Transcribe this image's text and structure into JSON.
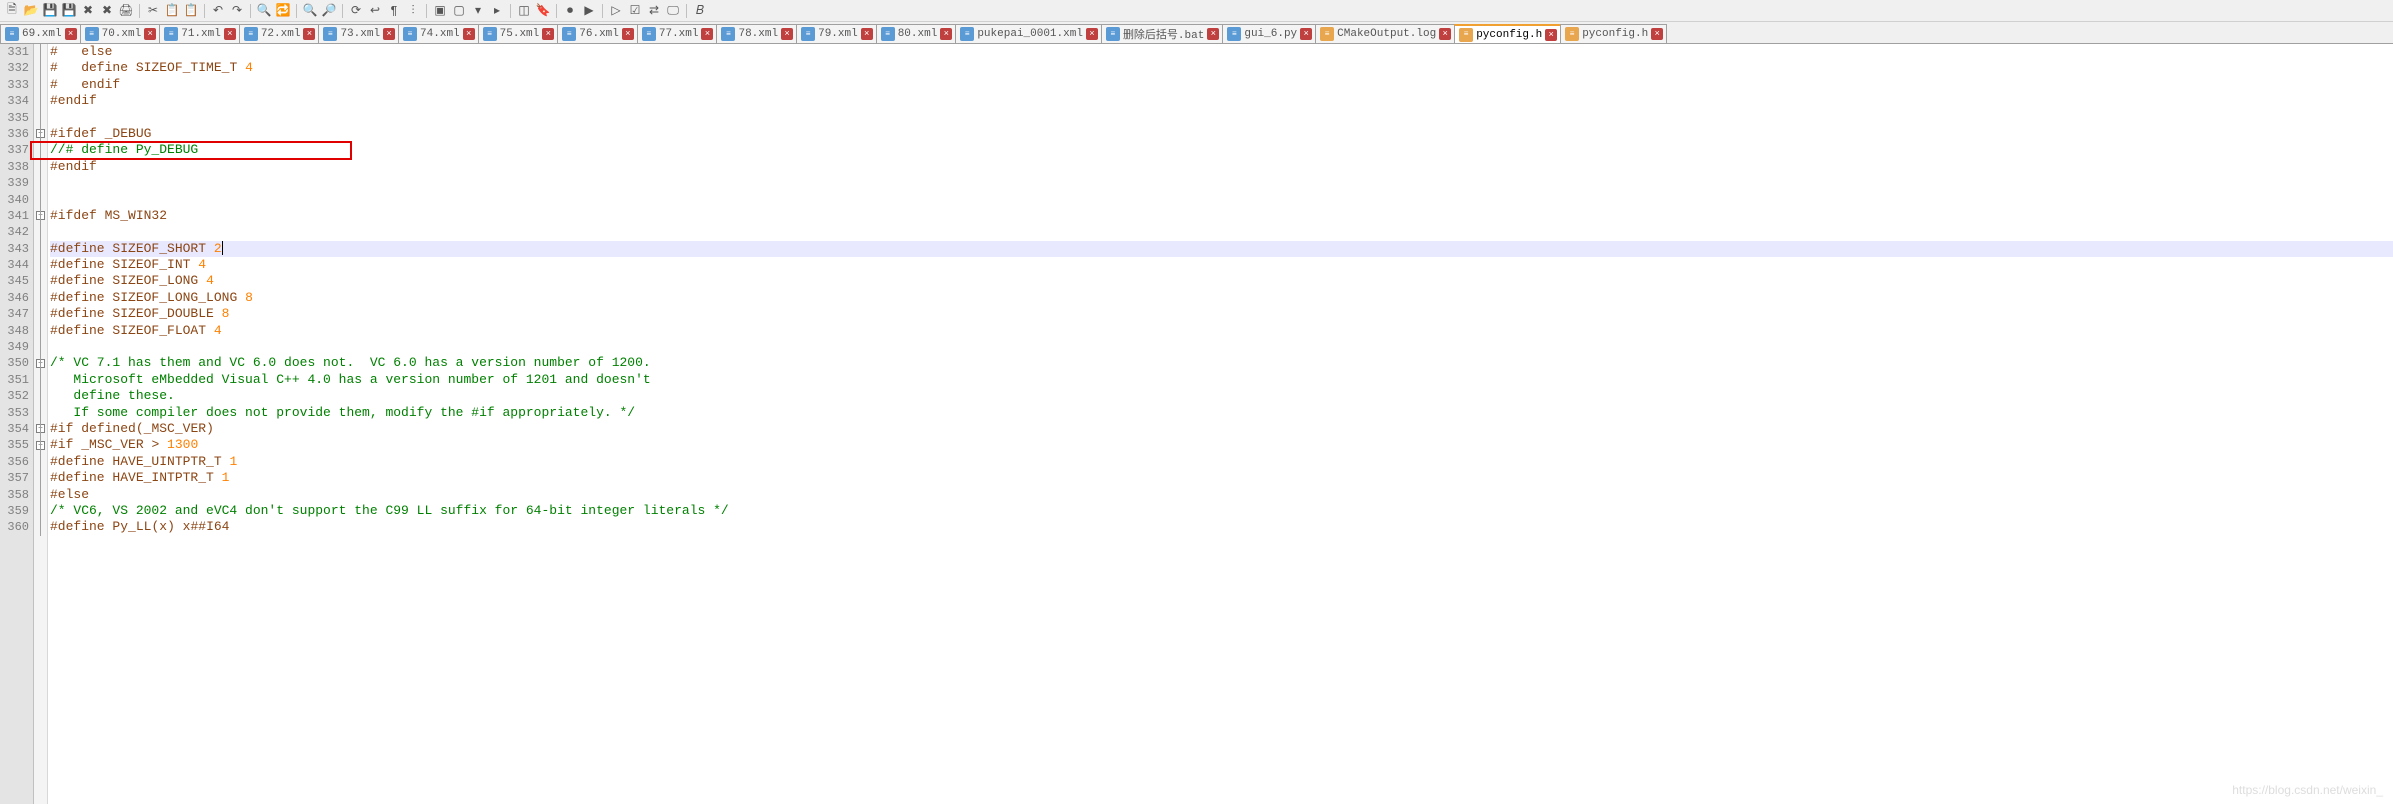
{
  "toolbar_icons": [
    "new-file",
    "open-file",
    "save",
    "save-all",
    "close",
    "close-all",
    "print",
    "sep",
    "cut",
    "copy",
    "paste",
    "sep",
    "undo",
    "redo",
    "sep",
    "find",
    "replace",
    "sep",
    "zoom-in",
    "zoom-out",
    "sep",
    "sync",
    "word-wrap",
    "show-all",
    "indent-guide",
    "sep",
    "fold-all",
    "unfold-all",
    "collapse",
    "expand",
    "sep",
    "hide-lines",
    "bookmark",
    "sep",
    "record-macro",
    "play-macro",
    "sep",
    "run",
    "toggle",
    "compare",
    "monitor",
    "sep",
    "bold"
  ],
  "tabs": [
    {
      "label": "69.xml",
      "type": "xml"
    },
    {
      "label": "70.xml",
      "type": "xml"
    },
    {
      "label": "71.xml",
      "type": "xml"
    },
    {
      "label": "72.xml",
      "type": "xml"
    },
    {
      "label": "73.xml",
      "type": "xml"
    },
    {
      "label": "74.xml",
      "type": "xml"
    },
    {
      "label": "75.xml",
      "type": "xml"
    },
    {
      "label": "76.xml",
      "type": "xml"
    },
    {
      "label": "77.xml",
      "type": "xml"
    },
    {
      "label": "78.xml",
      "type": "xml"
    },
    {
      "label": "79.xml",
      "type": "xml"
    },
    {
      "label": "80.xml",
      "type": "xml"
    },
    {
      "label": "pukepai_0001.xml",
      "type": "xml"
    },
    {
      "label": "删除后括号.bat",
      "type": "bat"
    },
    {
      "label": "gui_6.py",
      "type": "py"
    },
    {
      "label": "CMakeOutput.log",
      "type": "log"
    },
    {
      "label": "pyconfig.h",
      "type": "h",
      "active": true
    },
    {
      "label": "pyconfig.h",
      "type": "h"
    }
  ],
  "first_line": 331,
  "highlighted_box_line": 337,
  "code": [
    {
      "n": 331,
      "seg": [
        {
          "c": "mac",
          "t": "#   else"
        }
      ]
    },
    {
      "n": 332,
      "seg": [
        {
          "c": "mac",
          "t": "#   define "
        },
        {
          "c": "kw",
          "t": "SIZEOF_TIME_T"
        },
        {
          "c": "",
          "t": " "
        },
        {
          "c": "num",
          "t": "4"
        }
      ]
    },
    {
      "n": 333,
      "seg": [
        {
          "c": "mac",
          "t": "#   endif"
        }
      ]
    },
    {
      "n": 334,
      "seg": [
        {
          "c": "mac",
          "t": "#endif"
        }
      ]
    },
    {
      "n": 335,
      "seg": []
    },
    {
      "n": 336,
      "seg": [
        {
          "c": "mac",
          "t": "#ifdef "
        },
        {
          "c": "kw",
          "t": "_DEBUG"
        }
      ],
      "fold": "open"
    },
    {
      "n": 337,
      "seg": [
        {
          "c": "comment",
          "t": "//# define Py_DEBUG"
        }
      ]
    },
    {
      "n": 338,
      "seg": [
        {
          "c": "mac",
          "t": "#endif"
        }
      ]
    },
    {
      "n": 339,
      "seg": []
    },
    {
      "n": 340,
      "seg": []
    },
    {
      "n": 341,
      "seg": [
        {
          "c": "mac",
          "t": "#ifdef "
        },
        {
          "c": "kw",
          "t": "MS_WIN32"
        }
      ],
      "fold": "open"
    },
    {
      "n": 342,
      "seg": []
    },
    {
      "n": 343,
      "seg": [
        {
          "c": "mac",
          "t": "#define "
        },
        {
          "c": "kw",
          "t": "SIZEOF_SHORT"
        },
        {
          "c": "",
          "t": " "
        },
        {
          "c": "num",
          "t": "2"
        }
      ],
      "hl": true
    },
    {
      "n": 344,
      "seg": [
        {
          "c": "mac",
          "t": "#define "
        },
        {
          "c": "kw",
          "t": "SIZEOF_INT"
        },
        {
          "c": "",
          "t": " "
        },
        {
          "c": "num",
          "t": "4"
        }
      ]
    },
    {
      "n": 345,
      "seg": [
        {
          "c": "mac",
          "t": "#define "
        },
        {
          "c": "kw",
          "t": "SIZEOF_LONG"
        },
        {
          "c": "",
          "t": " "
        },
        {
          "c": "num",
          "t": "4"
        }
      ]
    },
    {
      "n": 346,
      "seg": [
        {
          "c": "mac",
          "t": "#define "
        },
        {
          "c": "kw",
          "t": "SIZEOF_LONG_LONG"
        },
        {
          "c": "",
          "t": " "
        },
        {
          "c": "num",
          "t": "8"
        }
      ]
    },
    {
      "n": 347,
      "seg": [
        {
          "c": "mac",
          "t": "#define "
        },
        {
          "c": "kw",
          "t": "SIZEOF_DOUBLE"
        },
        {
          "c": "",
          "t": " "
        },
        {
          "c": "num",
          "t": "8"
        }
      ]
    },
    {
      "n": 348,
      "seg": [
        {
          "c": "mac",
          "t": "#define "
        },
        {
          "c": "kw",
          "t": "SIZEOF_FLOAT"
        },
        {
          "c": "",
          "t": " "
        },
        {
          "c": "num",
          "t": "4"
        }
      ]
    },
    {
      "n": 349,
      "seg": []
    },
    {
      "n": 350,
      "seg": [
        {
          "c": "comment",
          "t": "/* VC 7.1 has them and VC 6.0 does not.  VC 6.0 has a version number of 1200."
        }
      ],
      "fold": "open"
    },
    {
      "n": 351,
      "seg": [
        {
          "c": "comment",
          "t": "   Microsoft eMbedded Visual C++ 4.0 has a version number of 1201 and doesn't"
        }
      ]
    },
    {
      "n": 352,
      "seg": [
        {
          "c": "comment",
          "t": "   define these."
        }
      ]
    },
    {
      "n": 353,
      "seg": [
        {
          "c": "comment",
          "t": "   If some compiler does not provide them, modify the #if appropriately. */"
        }
      ]
    },
    {
      "n": 354,
      "seg": [
        {
          "c": "mac",
          "t": "#if "
        },
        {
          "c": "kw",
          "t": "defined"
        },
        {
          "c": "mac",
          "t": "("
        },
        {
          "c": "kw",
          "t": "_MSC_VER"
        },
        {
          "c": "mac",
          "t": ")"
        }
      ],
      "fold": "open"
    },
    {
      "n": 355,
      "seg": [
        {
          "c": "mac",
          "t": "#if "
        },
        {
          "c": "kw",
          "t": "_MSC_VER"
        },
        {
          "c": "mac",
          "t": " > "
        },
        {
          "c": "num",
          "t": "1300"
        }
      ],
      "fold": "open"
    },
    {
      "n": 356,
      "seg": [
        {
          "c": "mac",
          "t": "#define "
        },
        {
          "c": "kw",
          "t": "HAVE_UINTPTR_T"
        },
        {
          "c": "",
          "t": " "
        },
        {
          "c": "num",
          "t": "1"
        }
      ]
    },
    {
      "n": 357,
      "seg": [
        {
          "c": "mac",
          "t": "#define "
        },
        {
          "c": "kw",
          "t": "HAVE_INTPTR_T"
        },
        {
          "c": "",
          "t": " "
        },
        {
          "c": "num",
          "t": "1"
        }
      ]
    },
    {
      "n": 358,
      "seg": [
        {
          "c": "mac",
          "t": "#else"
        }
      ]
    },
    {
      "n": 359,
      "seg": [
        {
          "c": "comment",
          "t": "/* VC6, VS 2002 and eVC4 don't support the C99 LL suffix for 64-bit integer literals */"
        }
      ]
    },
    {
      "n": 360,
      "seg": [
        {
          "c": "mac",
          "t": "#define "
        },
        {
          "c": "kw",
          "t": "Py_LL"
        },
        {
          "c": "mac",
          "t": "("
        },
        {
          "c": "kw",
          "t": "x"
        },
        {
          "c": "mac",
          "t": ") x##"
        },
        {
          "c": "kw",
          "t": "I64"
        }
      ]
    }
  ],
  "watermark": "https://blog.csdn.net/weixin_"
}
